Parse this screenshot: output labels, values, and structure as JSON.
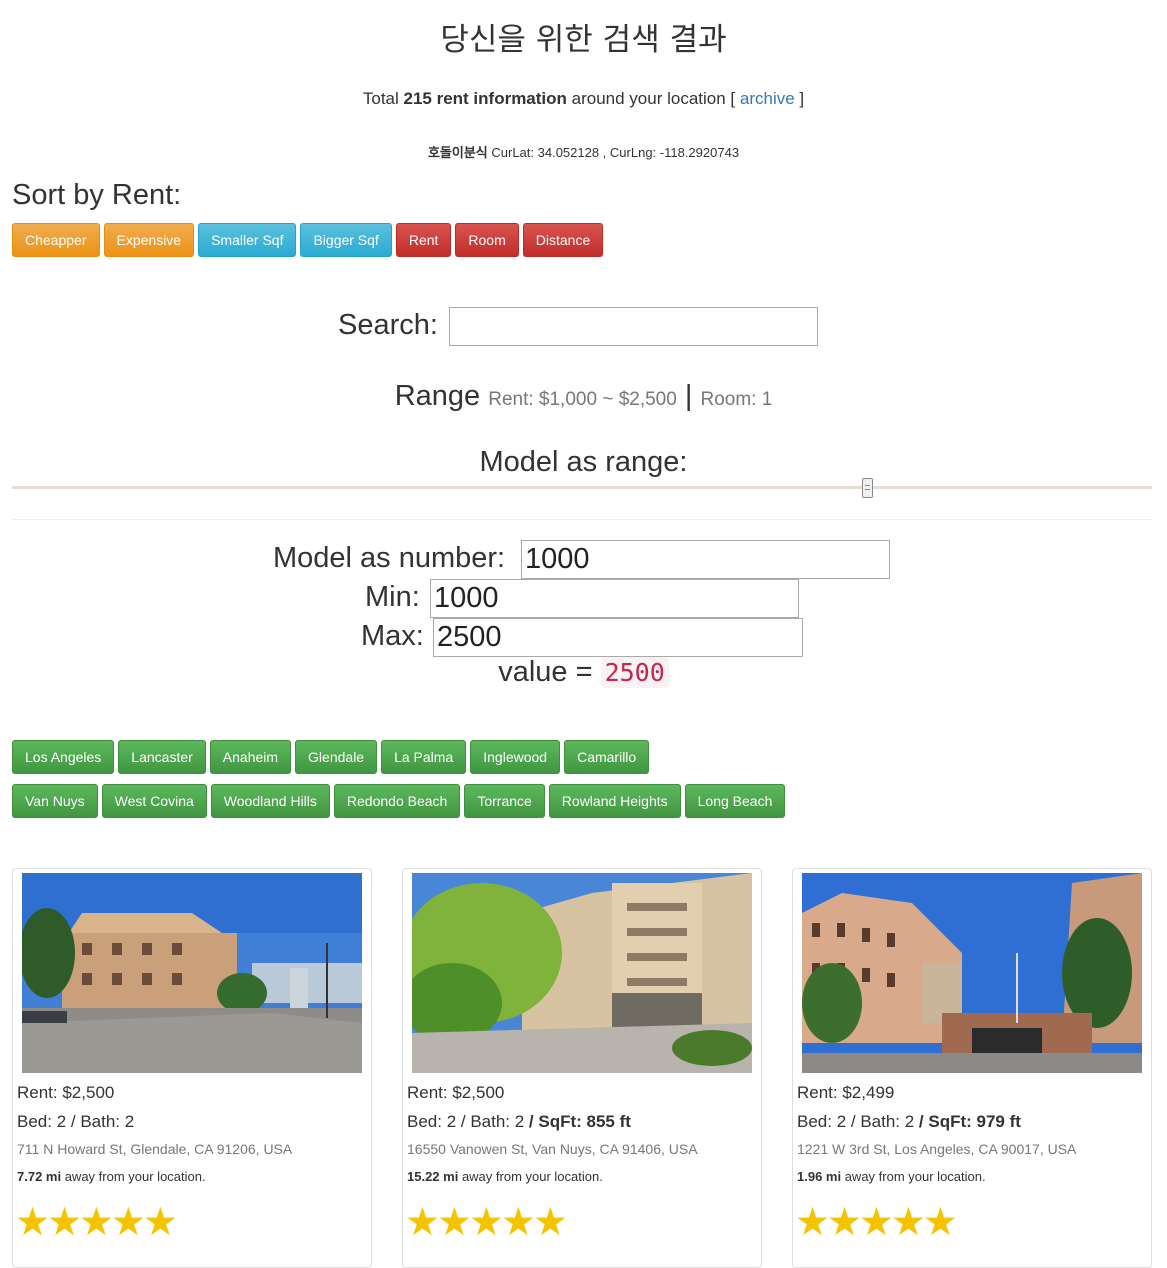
{
  "page": {
    "title": "당신을 위한 검색 결과",
    "summary": {
      "prefix": "Total ",
      "count_text": "215 rent information",
      "suffix": " around your location [ ",
      "archive_link": "archive",
      "close": " ]"
    },
    "location": {
      "name": "호돌이분식",
      "coords": " CurLat: 34.052128 , CurLng: -118.2920743"
    }
  },
  "sort": {
    "heading": "Sort by Rent:",
    "buttons": [
      {
        "label": "Cheapper",
        "style": "warning"
      },
      {
        "label": "Expensive",
        "style": "warning"
      },
      {
        "label": "Smaller Sqf",
        "style": "info"
      },
      {
        "label": "Bigger Sqf",
        "style": "info"
      },
      {
        "label": "Rent",
        "style": "danger"
      },
      {
        "label": "Room",
        "style": "danger"
      },
      {
        "label": "Distance",
        "style": "danger"
      }
    ]
  },
  "search": {
    "label": "Search:",
    "value": ""
  },
  "range": {
    "heading": "Range",
    "rent": "Rent: $1,000 ~ $2,500",
    "separator": "|",
    "room": "Room: 1"
  },
  "model": {
    "range_label": "Model as range:",
    "slider_fraction": 0.75,
    "number_label": "Model as number:",
    "number_value": "1000",
    "min_label": "Min:",
    "min_value": "1000",
    "max_label": "Max:",
    "max_value": "2500",
    "value_label": "value = ",
    "value": "2500"
  },
  "cities": {
    "row1": [
      "Los Angeles",
      "Lancaster",
      "Anaheim",
      "Glendale",
      "La Palma",
      "Inglewood",
      "Camarillo"
    ],
    "row2": [
      "Van Nuys",
      "West Covina",
      "Woodland Hills",
      "Redondo Beach",
      "Torrance",
      "Rowland Heights",
      "Long Beach"
    ]
  },
  "listings": [
    {
      "rent": "Rent: $2,500",
      "bed_bath": "Bed: 2 / Bath: 2",
      "sqft": "",
      "address": "711 N Howard St, Glendale, CA 91206, USA",
      "distance": "7.72 mi",
      "distance_suffix": " away from your location.",
      "stars": "★★★★★"
    },
    {
      "rent": "Rent: $2,500",
      "bed_bath": "Bed: 2 / Bath: 2",
      "sqft": " / SqFt: 855 ft",
      "address": "16550 Vanowen St, Van Nuys, CA 91406, USA",
      "distance": "15.22 mi",
      "distance_suffix": " away from your location.",
      "stars": "★★★★★"
    },
    {
      "rent": "Rent: $2,499",
      "bed_bath": "Bed: 2 / Bath: 2",
      "sqft": " / SqFt: 979 ft",
      "address": "1221 W 3rd St, Los Angeles, CA 90017, USA",
      "distance": "1.96 mi",
      "distance_suffix": " away from your location.",
      "stars": "★★★★★"
    }
  ]
}
